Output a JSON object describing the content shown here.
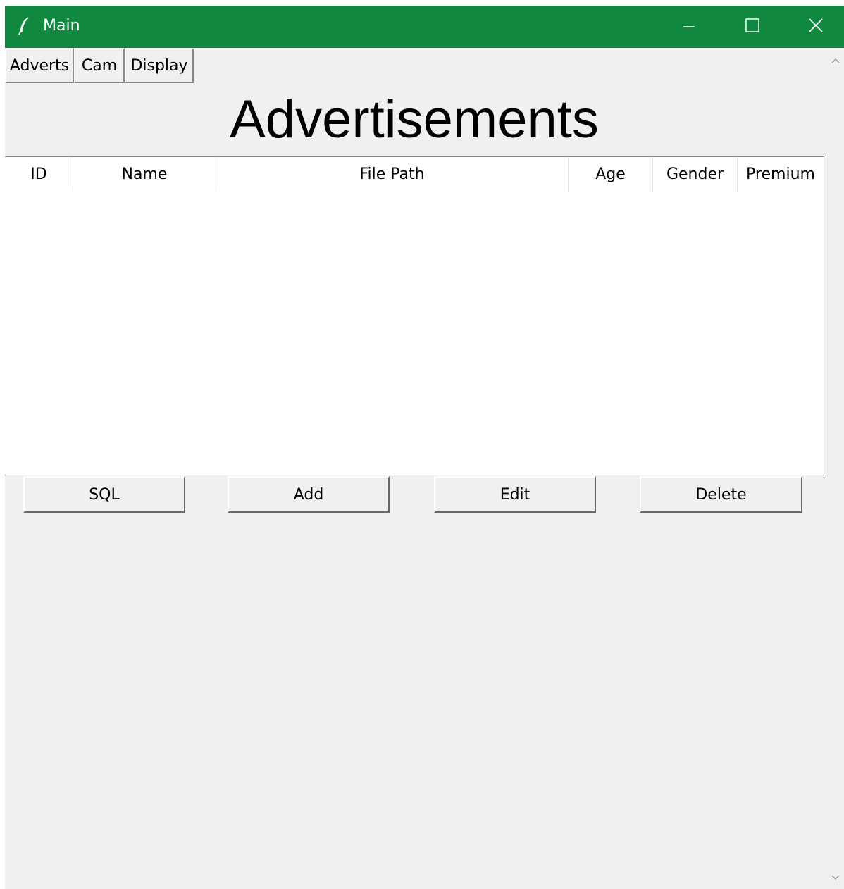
{
  "window": {
    "title": "Main",
    "title_bar_color": "#118840"
  },
  "menu": {
    "items": [
      {
        "label": "Adverts"
      },
      {
        "label": "Cam"
      },
      {
        "label": "Display"
      }
    ]
  },
  "main": {
    "heading": "Advertisements",
    "table": {
      "columns": [
        "ID",
        "Name",
        "File Path",
        "Age",
        "Gender",
        "Premium"
      ],
      "rows": []
    },
    "actions": {
      "sql_label": "SQL",
      "add_label": "Add",
      "edit_label": "Edit",
      "delete_label": "Delete"
    }
  },
  "icons": {
    "app": "feather-icon",
    "minimize": "minimize-icon",
    "maximize": "maximize-icon",
    "close": "close-icon",
    "scroll_up": "chevron-up-icon",
    "scroll_down": "chevron-down-icon"
  }
}
